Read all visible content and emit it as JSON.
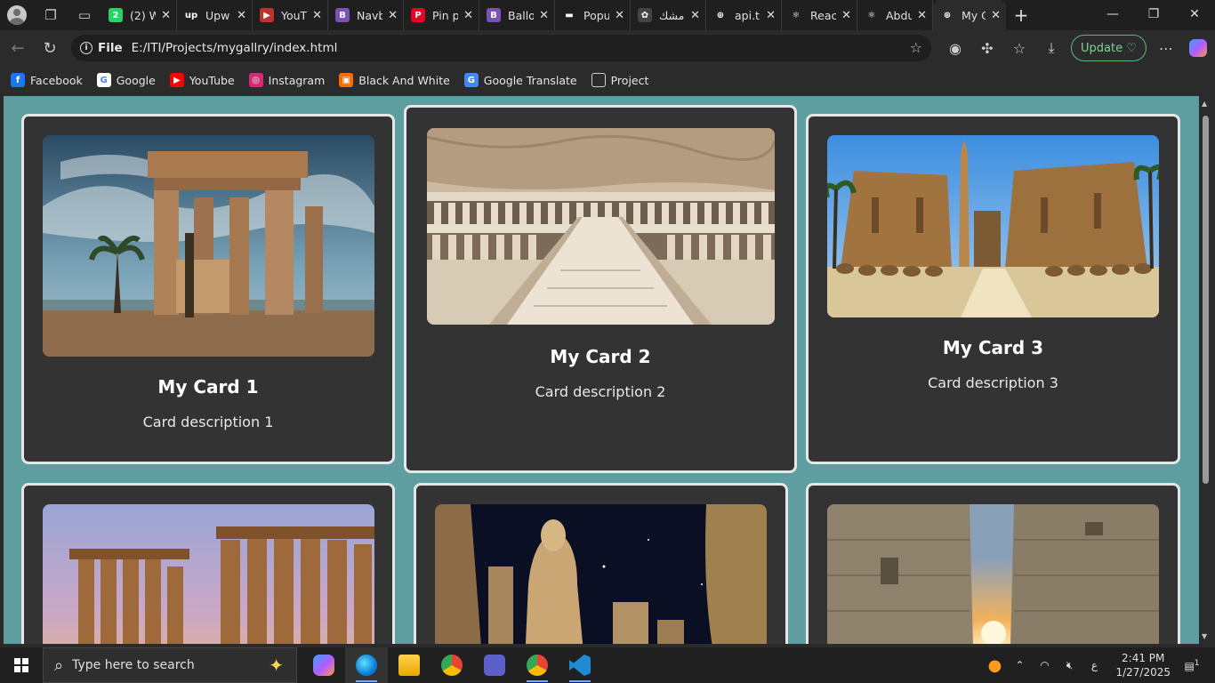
{
  "browser": {
    "tabs": [
      {
        "label": "(2) W",
        "icon": "whatsapp-icon",
        "color": "#25d366",
        "glyph": "2"
      },
      {
        "label": "Upw",
        "icon": "upwork-icon",
        "color": "#1f1f1f",
        "glyph": "up"
      },
      {
        "label": "YouT",
        "icon": "youtube-icon",
        "color": "#c4302b",
        "glyph": "▶"
      },
      {
        "label": "Navb",
        "icon": "bootstrap-icon",
        "color": "#7952b3",
        "glyph": "B"
      },
      {
        "label": "Pin p",
        "icon": "pinterest-icon",
        "color": "#e60023",
        "glyph": "P"
      },
      {
        "label": "Ballo",
        "icon": "bootstrap-icon",
        "color": "#7952b3",
        "glyph": "B"
      },
      {
        "label": "Popu",
        "icon": "popular-icon",
        "color": "#1f1f1f",
        "glyph": "▬"
      },
      {
        "label": "مشك",
        "icon": "openai-icon",
        "color": "#444444",
        "glyph": "✿"
      },
      {
        "label": "api.t",
        "icon": "globe-icon",
        "color": "#1f1f1f",
        "glyph": "⊕"
      },
      {
        "label": "Reac",
        "icon": "react-icon",
        "color": "#1f1f1f",
        "glyph": "⚛"
      },
      {
        "label": "Abdu",
        "icon": "react-icon",
        "color": "#1f1f1f",
        "glyph": "⚛"
      },
      {
        "label": "My C",
        "icon": "globe-icon",
        "color": "#2b2b2b",
        "glyph": "⊕",
        "active": true
      }
    ],
    "address": {
      "scheme": "File",
      "url": "E:/ITI/Projects/mygallry/index.html"
    },
    "update_label": "Update",
    "favorites": [
      {
        "label": "Facebook",
        "icon": "facebook-icon",
        "color": "#1877f2",
        "glyph": "f"
      },
      {
        "label": "Google",
        "icon": "google-icon",
        "color": "#ffffff",
        "glyph": "G"
      },
      {
        "label": "YouTube",
        "icon": "youtube-icon",
        "color": "#ff0000",
        "glyph": "▶"
      },
      {
        "label": "Instagram",
        "icon": "instagram-icon",
        "color": "#d62976",
        "glyph": "◎"
      },
      {
        "label": "Black And White",
        "icon": "bw-icon",
        "color": "#ff6a00",
        "glyph": "▣"
      },
      {
        "label": "Google Translate",
        "icon": "translate-icon",
        "color": "#4285f4",
        "glyph": "G"
      },
      {
        "label": "Project",
        "icon": "folder-icon",
        "color": "#2b2b2b",
        "glyph": "▢"
      }
    ]
  },
  "page": {
    "background": "#5f9ea0",
    "cards": [
      {
        "title": "My Card 1",
        "description": "Card description 1",
        "image": "temple-of-philae"
      },
      {
        "title": "My Card 2",
        "description": "Card description 2",
        "image": "temple-of-hatshepsut"
      },
      {
        "title": "My Card 3",
        "description": "Card description 3",
        "image": "luxor-temple-entrance"
      },
      {
        "title": "",
        "description": "",
        "image": "luxor-colonnade-sunset"
      },
      {
        "title": "",
        "description": "",
        "image": "ramses-statue-night"
      },
      {
        "title": "",
        "description": "",
        "image": "karnak-pylon-sunrise"
      }
    ]
  },
  "taskbar": {
    "search_placeholder": "Type here to search",
    "time": "2:41 PM",
    "date": "1/27/2025",
    "lang": "ع",
    "notification_count": "1"
  }
}
